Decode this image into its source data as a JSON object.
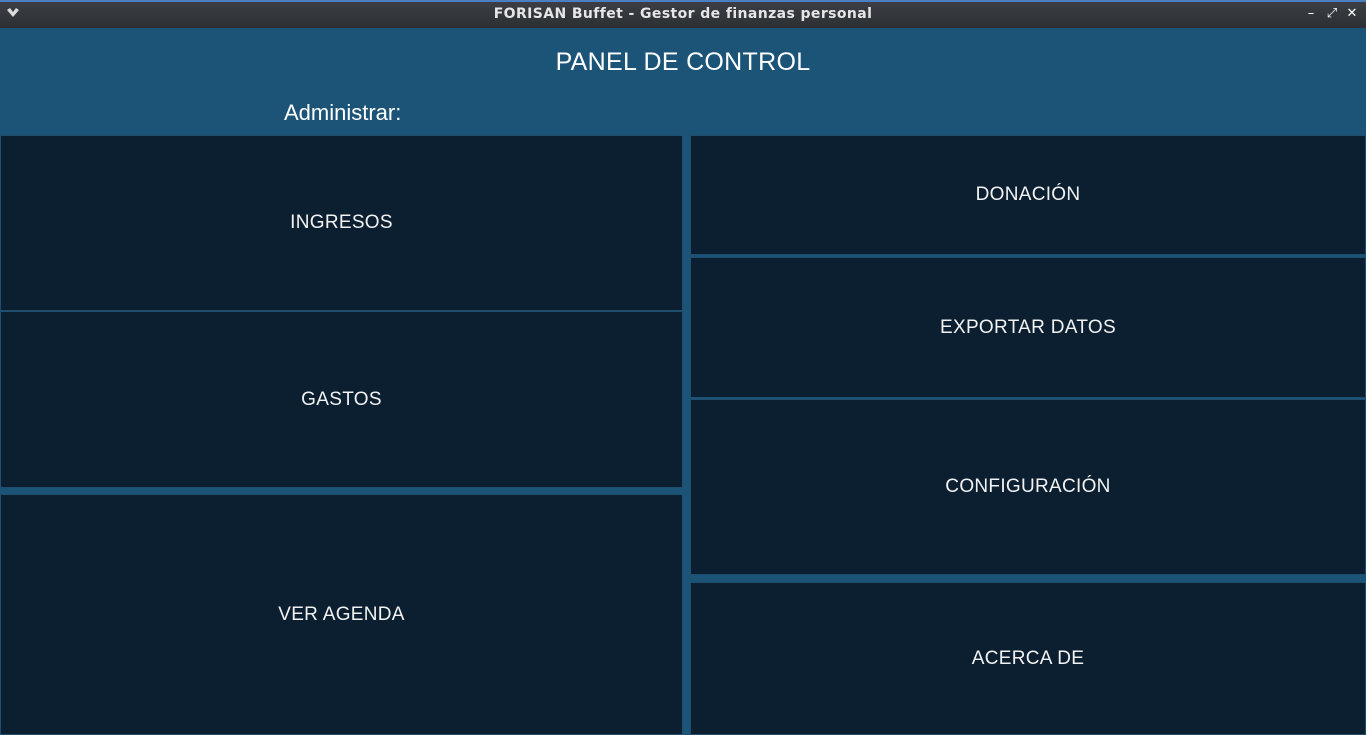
{
  "window": {
    "title": "FORISAN Buffet - Gestor de finanzas personal",
    "app_icon": "app-menu-icon",
    "controls": {
      "minimize": "–",
      "maximize": "⤢",
      "close": "✕"
    }
  },
  "header": {
    "title": "PANEL DE CONTROL",
    "admin_label": "Administrar:"
  },
  "left_tiles": {
    "ingresos": "INGRESOS",
    "gastos": "GASTOS",
    "ver_agenda": "VER AGENDA"
  },
  "right_tiles": {
    "donacion": "DONACIÓN",
    "exportar": "EXPORTAR DATOS",
    "configuracion": "CONFIGURACIÓN",
    "acerca": "ACERCA DE"
  },
  "colors": {
    "background": "#1c5478",
    "tile": "#0c1f30",
    "titlebar": "#2f3236"
  }
}
